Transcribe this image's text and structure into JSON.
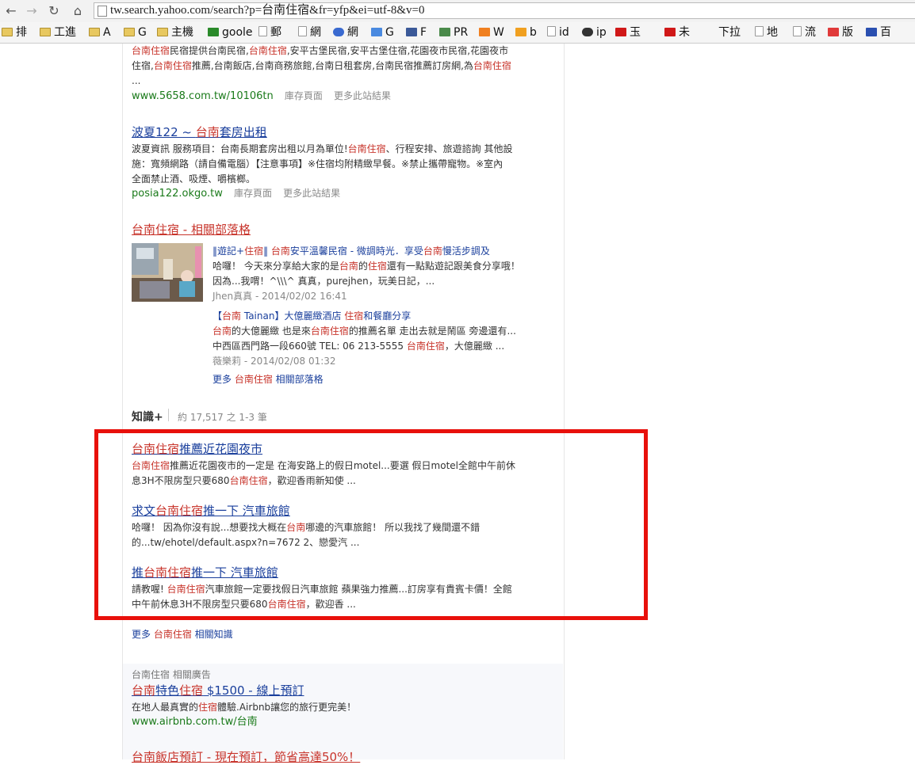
{
  "browser": {
    "url": "tw.search.yahoo.com/search?p=台南住宿&fr=yfp&ei=utf-8&v=0",
    "bookmarks": [
      "排",
      "工進",
      "A",
      "G",
      "主機",
      "goole",
      "郵",
      "網",
      "網",
      "G",
      "F",
      "PR",
      "W",
      "b",
      "id",
      "ip",
      "玉",
      "未",
      "下拉",
      "地",
      "流",
      "版",
      "百"
    ]
  },
  "results": [
    {
      "snippet_lines": [
        [
          {
            "h": true,
            "t": "台南住宿"
          },
          {
            "h": false,
            "t": "民宿提供台南民宿,"
          },
          {
            "h": true,
            "t": "台南住宿"
          },
          {
            "h": false,
            "t": ",安平古堡民宿,安平古堡住宿,花園夜市民宿,花園夜市"
          }
        ],
        [
          {
            "h": false,
            "t": "住宿,"
          },
          {
            "h": true,
            "t": "台南住宿"
          },
          {
            "h": false,
            "t": "推薦,台南飯店,台南商務旅館,台南日租套房,台南民宿推薦訂房網,為"
          },
          {
            "h": true,
            "t": "台南住宿"
          }
        ],
        [
          {
            "h": false,
            "t": "..."
          }
        ]
      ],
      "url": "www.5658.com.tw/10106tn",
      "cache": "庫存頁面",
      "more": "更多此站結果"
    },
    {
      "title": [
        {
          "h": false,
          "t": "波夏122 ~ "
        },
        {
          "h": true,
          "t": "台南"
        },
        {
          "h": false,
          "t": "套房出租"
        }
      ],
      "snippet_lines": [
        [
          {
            "h": false,
            "t": "波夏資訊 服務項目：台南長期套房出租以月為單位!"
          },
          {
            "h": true,
            "t": "台南住宿"
          },
          {
            "h": false,
            "t": "、行程安排、旅遊諮詢 其他設"
          }
        ],
        [
          {
            "h": false,
            "t": "施：寬頻網路（請自備電腦）【注意事項】※住宿均附精緻早餐。※禁止攜帶寵物。※室內"
          }
        ],
        [
          {
            "h": false,
            "t": "全面禁止酒、吸煙、嚼檳榔。"
          }
        ]
      ],
      "url": "posia122.okgo.tw",
      "cache": "庫存頁面",
      "more": "更多此站結果"
    }
  ],
  "blog": {
    "title": "台南住宿 - 相關部落格",
    "post1": {
      "title": [
        {
          "h": false,
          "t": "‖遊記+"
        },
        {
          "h": true,
          "t": "住宿"
        },
        {
          "h": false,
          "t": "‖ "
        },
        {
          "h": true,
          "t": "台南"
        },
        {
          "h": false,
          "t": "安平溫馨民宿 - 微調時光．享受"
        },
        {
          "h": true,
          "t": "台南"
        },
        {
          "h": false,
          "t": "慢活步調及"
        }
      ],
      "lines": [
        [
          {
            "h": false,
            "t": "哈囉！ 今天來分享給大家的是"
          },
          {
            "h": true,
            "t": "台南"
          },
          {
            "h": false,
            "t": "的"
          },
          {
            "h": true,
            "t": "住宿"
          },
          {
            "h": false,
            "t": "還有一點點遊記跟美食分享哦！"
          }
        ],
        [
          {
            "h": false,
            "t": "因為...我喟！^\\\\\\^ 真真，purejhen，玩美日記，..."
          }
        ]
      ],
      "meta": "Jhen真真 - 2014/02/02 16:41"
    },
    "post2": {
      "title": [
        {
          "h": false,
          "t": "【"
        },
        {
          "h": true,
          "t": "台南"
        },
        {
          "h": false,
          "t": " Tainan】大億麗緻酒店 "
        },
        {
          "h": true,
          "t": "住宿"
        },
        {
          "h": false,
          "t": "和餐廳分享"
        }
      ],
      "lines": [
        [
          {
            "h": true,
            "t": "台南"
          },
          {
            "h": false,
            "t": "的大億麗緻 也是來"
          },
          {
            "h": true,
            "t": "台南住宿"
          },
          {
            "h": false,
            "t": "的推薦名單 走出去就是鬧區 旁邊還有..."
          }
        ],
        [
          {
            "h": false,
            "t": "中西區西門路一段660號 TEL: 06 213-5555 "
          },
          {
            "h": true,
            "t": "台南住宿"
          },
          {
            "h": false,
            "t": "，大億麗緻 ..."
          }
        ]
      ],
      "meta": "薇樂莉 - 2014/02/08 01:32"
    },
    "more": [
      {
        "h": false,
        "t": "更多 "
      },
      {
        "h": true,
        "t": "台南住宿"
      },
      {
        "h": false,
        "t": " 相關部落格"
      }
    ]
  },
  "knowledge": {
    "label": "知識+",
    "count": "約 17,517 之 1-3 筆",
    "items": [
      {
        "title": [
          {
            "h": true,
            "t": "台南住宿"
          },
          {
            "h": false,
            "t": "推薦近花園夜市"
          }
        ],
        "lines": [
          [
            {
              "h": true,
              "t": "台南住宿"
            },
            {
              "h": false,
              "t": "推薦近花園夜市的一定是 在海安路上的假日motel...要選 假日motel全館中午前休"
            }
          ],
          [
            {
              "h": false,
              "t": "息3H不限房型只要680"
            },
            {
              "h": true,
              "t": "台南住宿"
            },
            {
              "h": false,
              "t": "，歡迎香雨新知使 ..."
            }
          ]
        ]
      },
      {
        "title": [
          {
            "h": false,
            "t": "求文"
          },
          {
            "h": true,
            "t": "台南住宿"
          },
          {
            "h": false,
            "t": "推一下 汽車旅館"
          }
        ],
        "lines": [
          [
            {
              "h": false,
              "t": "哈囉！ 因為你沒有說...想要找大概在"
            },
            {
              "h": true,
              "t": "台南"
            },
            {
              "h": false,
              "t": "哪邊的汽車旅館！ 所以我找了幾間還不錯"
            }
          ],
          [
            {
              "h": false,
              "t": "的...tw/ehotel/default.aspx?n=7672 2、戀愛汽 ..."
            }
          ]
        ]
      },
      {
        "title": [
          {
            "h": false,
            "t": "推"
          },
          {
            "h": true,
            "t": "台南住宿"
          },
          {
            "h": false,
            "t": "推一下 汽車旅館"
          }
        ],
        "lines": [
          [
            {
              "h": false,
              "t": "請教喔! "
            },
            {
              "h": true,
              "t": "台南住宿"
            },
            {
              "h": false,
              "t": "汽車旅館一定要找假日汽車旅館 蘋果強力推薦...訂房享有貴賓卡價！全館"
            }
          ],
          [
            {
              "h": false,
              "t": "中午前休息3H不限房型只要680"
            },
            {
              "h": true,
              "t": "台南住宿"
            },
            {
              "h": false,
              "t": "，歡迎香 ..."
            }
          ]
        ]
      }
    ],
    "more": [
      {
        "h": false,
        "t": "更多 "
      },
      {
        "h": true,
        "t": "台南住宿"
      },
      {
        "h": false,
        "t": " 相關知識"
      }
    ]
  },
  "ads": {
    "label": "台南住宿 相關廣告",
    "ad1": {
      "title": [
        {
          "h": true,
          "t": "台南"
        },
        {
          "h": false,
          "t": "特色"
        },
        {
          "h": true,
          "t": "住宿"
        },
        {
          "h": false,
          "t": " $1500 - 線上預訂 "
        }
      ],
      "line": [
        {
          "h": false,
          "t": "在地人最真實的"
        },
        {
          "h": true,
          "t": "住宿"
        },
        {
          "h": false,
          "t": "體驗.Airbnb讓您的旅行更完美！"
        }
      ],
      "url": "www.airbnb.com.tw/台南"
    },
    "ad2_title": "台南飯店預訂 - 現在預訂，節省高達50%！"
  }
}
